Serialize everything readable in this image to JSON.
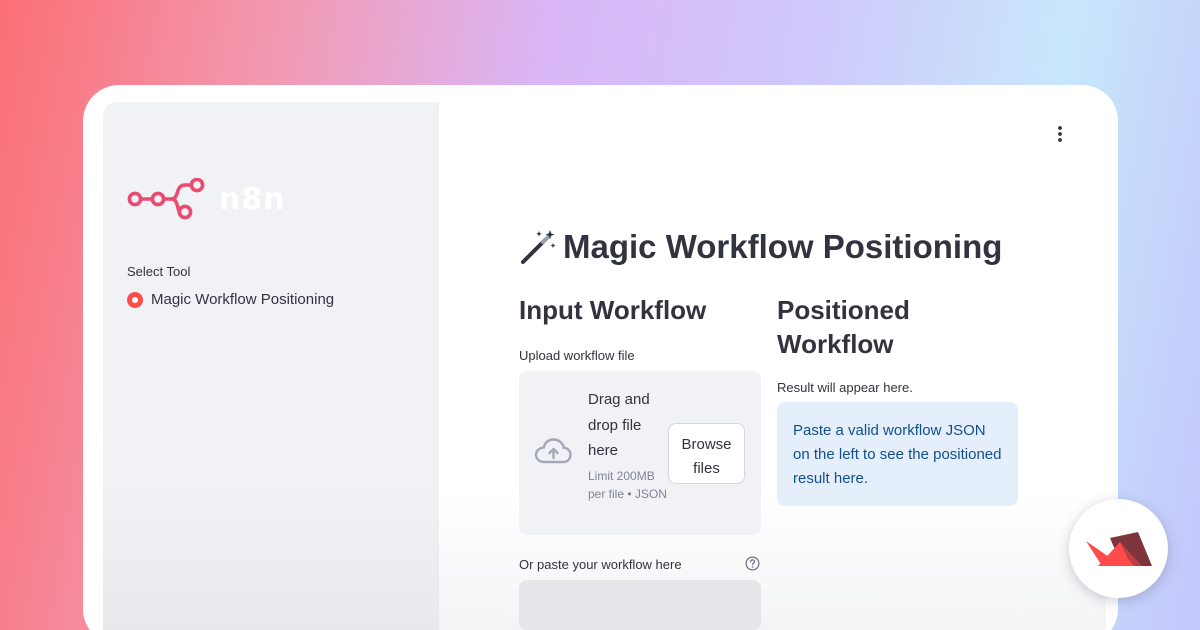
{
  "sidebar": {
    "logo_text": "n8n",
    "select_label": "Select Tool",
    "tools": [
      {
        "label": "Magic Workflow Positioning",
        "selected": true
      }
    ]
  },
  "main": {
    "title": "Magic Workflow Positioning",
    "title_icon": "magic-wand-icon",
    "input": {
      "heading": "Input Workflow",
      "upload_label": "Upload workflow file",
      "dropzone_text": "Drag and drop file here",
      "dropzone_limit": "Limit 200MB per file • JSON",
      "browse_label": "Browse files",
      "paste_label": "Or paste your workflow here",
      "paste_value": ""
    },
    "output": {
      "heading": "Positioned Workflow",
      "result_label": "Result will appear here.",
      "info_message": "Paste a valid workflow JSON on the left to see the positioned result here."
    }
  },
  "colors": {
    "accent": "#ff4b4b",
    "logo": "#ea4b71",
    "info_bg": "#e5effb",
    "info_text": "#134f8c"
  },
  "icons": [
    "n8n-logo-icon",
    "magic-wand-icon",
    "more-vertical-icon",
    "cloud-upload-icon",
    "help-circle-icon",
    "streamlit-crown-icon"
  ]
}
